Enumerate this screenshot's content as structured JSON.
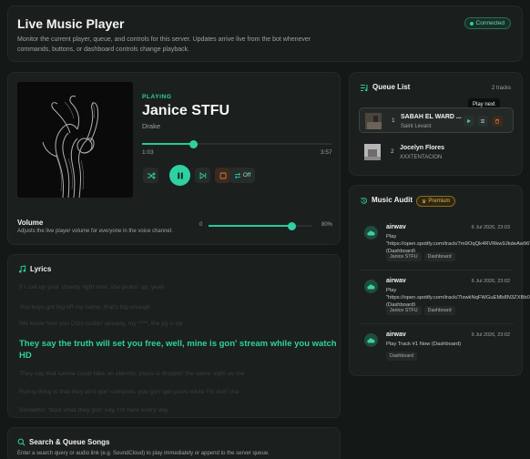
{
  "header": {
    "title": "Live Music Player",
    "description": "Monitor the current player, queue, and controls for this server. Updates arrive live from the bot whenever commands, buttons, or dashboard controls change playback.",
    "status": "Connected"
  },
  "player": {
    "status_label": "PLAYING",
    "track_title": "Janice STFU",
    "artist": "Drake",
    "elapsed": "1:03",
    "duration": "3:57",
    "progress_fraction": 0.27,
    "repeat_label": "Off",
    "volume_title": "Volume",
    "volume_description": "Adjusts the live player volume for everyone in the voice channel.",
    "volume_min": "0",
    "volume_value_label": "80%",
    "volume_fraction": 0.8
  },
  "lyrics": {
    "title": "Lyrics",
    "lines": [
      "If I call up your shawty right now, she pickin' up, yeah",
      "You boys got big off my name, that's big enough",
      "We know how you OGs rockin' already, my ****, the jig is up",
      "They say the truth will set you free, well, mine is gon' stream while you watch HD",
      "They say that karma could take an eternity, yours is droppin' the same night as me",
      "Funny thing is that they ain't gon' compete, you gon' get yours while I'm doin' me",
      "Somethin' 'bout what they gon' say, I'm here every day"
    ],
    "active_index": 3
  },
  "search": {
    "title": "Search & Queue Songs",
    "description": "Enter a search query or audio link (e.g. SoundCloud) to play immediately or append to the server queue."
  },
  "queue": {
    "title": "Queue List",
    "count_label": "2 tracks",
    "tooltip": "Play next",
    "items": [
      {
        "num": "1",
        "title": "SABAH EL WARD ...",
        "artist": "Saint Levant"
      },
      {
        "num": "2",
        "title": "Jocelyn Flores",
        "artist": "XXXTENTACION"
      }
    ]
  },
  "audit": {
    "title": "Music Audit",
    "badge": "Premium",
    "entries": [
      {
        "user": "airwav",
        "time": "6 Jul 2026, 23:03",
        "text": "Play \"https://open.spotify.com/track/7m9OqQk4RVRkw9JkdeAw96\" (Dashboard)",
        "tags": [
          "Janice STFU",
          "Dashboard"
        ]
      },
      {
        "user": "airwav",
        "time": "6 Jul 2026, 23:02",
        "text": "Play \"https://open.spotify.com/track/7IxwkNqFWGuEMb8N3ZXBb0\" (Dashboard)",
        "tags": [
          "Janice STFU",
          "Dashboard"
        ]
      },
      {
        "user": "airwav",
        "time": "6 Jul 2026, 23:02",
        "text": "Play Track #1 Now (Dashboard)",
        "tags": [
          "Dashboard"
        ]
      }
    ]
  },
  "colors": {
    "accent": "#2fd1a2",
    "background": "#141816",
    "card": "#1b201e",
    "premium": "#e3b44a"
  }
}
